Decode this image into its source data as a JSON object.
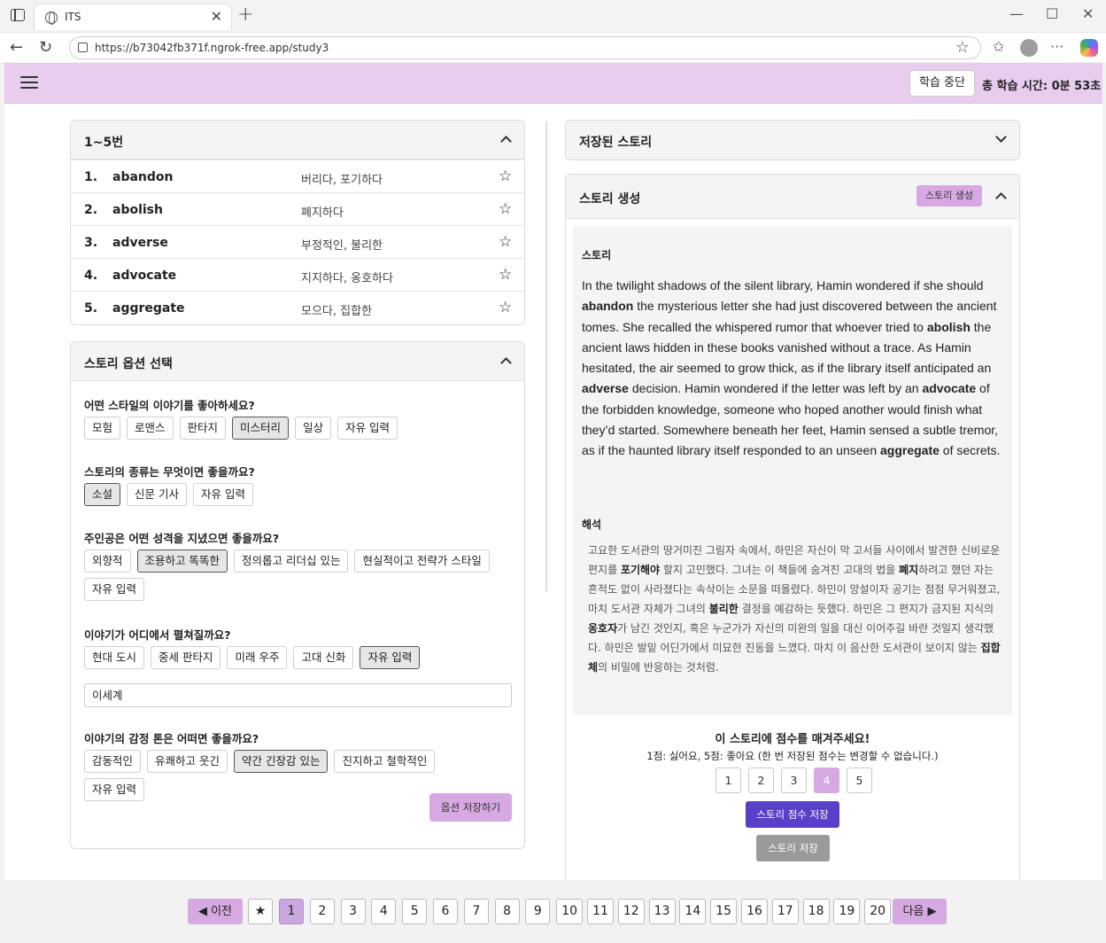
{
  "browser": {
    "tab_title": "ITS",
    "url": "https://b73042fb371f.ngrok-free.app/study3"
  },
  "header": {
    "stop_button": "학습 중단",
    "study_time": "총 학습 시간: 0분 53초"
  },
  "word_list": {
    "title": "1~5번",
    "items": [
      {
        "num": "1.",
        "en": "abandon",
        "ko": "버리다, 포기하다"
      },
      {
        "num": "2.",
        "en": "abolish",
        "ko": "폐지하다"
      },
      {
        "num": "3.",
        "en": "adverse",
        "ko": "부정적인, 불리한"
      },
      {
        "num": "4.",
        "en": "advocate",
        "ko": "지지하다, 옹호하다"
      },
      {
        "num": "5.",
        "en": "aggregate",
        "ko": "모으다, 집합한"
      }
    ]
  },
  "story_options": {
    "title": "스토리 옵션 선택",
    "questions": [
      {
        "label": "어떤 스타일의 이야기를 좋아하세요?",
        "options": [
          "모험",
          "로맨스",
          "판타지",
          "미스터리",
          "일상",
          "자유 입력"
        ],
        "selected": "미스터리"
      },
      {
        "label": "스토리의 종류는 무엇이면 좋을까요?",
        "options": [
          "소설",
          "신문 기사",
          "자유 입력"
        ],
        "selected": "소설"
      },
      {
        "label": "주인공은 어떤 성격을 지녔으면 좋을까요?",
        "options": [
          "외향적",
          "조용하고 똑똑한",
          "정의롭고 리더십 있는",
          "현실적이고 전략가 스타일",
          "자유 입력"
        ],
        "selected": "조용하고 똑똑한"
      },
      {
        "label": "이야기가 어디에서 펼쳐질까요?",
        "options": [
          "현대 도시",
          "중세 판타지",
          "미래 우주",
          "고대 신화",
          "자유 입력"
        ],
        "selected": "자유 입력"
      },
      {
        "label": "이야기의 감정 톤은 어떠면 좋을까요?",
        "options": [
          "감동적인",
          "유쾌하고 웃긴",
          "약간 긴장감 있는",
          "진지하고 철학적인",
          "자유 입력"
        ],
        "selected": "약간 긴장감 있는"
      }
    ],
    "location_input": "이세계",
    "save_button": "옵션 저장하기"
  },
  "saved_stories": {
    "title": "저장된 스토리"
  },
  "story_gen": {
    "title": "스토리 생성",
    "generate_button": "스토리 생성",
    "story_label": "스토리",
    "story_parts": [
      "In the twilight shadows of the silent library, Hamin wondered if she should ",
      "abandon",
      " the mysterious letter she had just discovered between the ancient tomes. She recalled the whispered rumor that whoever tried to ",
      "abolish",
      " the ancient laws hidden in these books vanished without a trace. As Hamin hesitated, the air seemed to grow thick, as if the library itself anticipated an ",
      "adverse",
      " decision. Hamin wondered if the letter was left by an ",
      "advocate",
      " of the forbidden knowledge, someone who hoped another would finish what they’d started. Somewhere beneath her feet, Hamin sensed a subtle tremor, as if the haunted library itself responded to an unseen ",
      "aggregate",
      " of secrets."
    ],
    "translation_label": "해석",
    "translation_parts": [
      "고요한 도서관의 땅거미진 그림자 속에서, 하민은 자신이 막 고서들 사이에서 발견한 신비로운 편지를 ",
      "포기해야",
      " 할지 고민했다. 그녀는 이 책들에 숨겨진 고대의 법을 ",
      "폐지",
      "하려고 했던 자는 흔적도 없이 사라졌다는 속삭이는 소문을 떠올렸다. 하민이 망설이자 공기는 점점 무거워졌고, 마치 도서관 자체가 그녀의 ",
      "불리한",
      " 결정을 예감하는 듯했다. 하민은 그 편지가 금지된 지식의 ",
      "옹호자",
      "가 남긴 것인지, 혹은 누군가가 자신의 미완의 일을 대신 이어주길 바란 것일지 생각했다. 하민은 발밑 어딘가에서 미묘한 진동을 느꼈다. 마치 이 음산한 도서관이 보이지 않는 ",
      "집합체",
      "의 비밀에 반응하는 것처럼."
    ],
    "rating_title": "이 스토리에 점수를 매겨주세요!",
    "rating_sub": "1점: 싫어요, 5점: 좋아요 (한 번 저장된 점수는 변경할 수 없습니다.)",
    "scores": [
      "1",
      "2",
      "3",
      "4",
      "5"
    ],
    "selected_score": "4",
    "score_save_button": "스토리 점수 저장",
    "story_save_button": "스토리 저장"
  },
  "pagination": {
    "prev": "◀ 이전",
    "star": "★",
    "pages": [
      "1",
      "2",
      "3",
      "4",
      "5",
      "6",
      "7",
      "8",
      "9",
      "10",
      "11",
      "12",
      "13",
      "14",
      "15",
      "16",
      "17",
      "18",
      "19",
      "20"
    ],
    "active": "1",
    "next": "다음 ▶"
  }
}
